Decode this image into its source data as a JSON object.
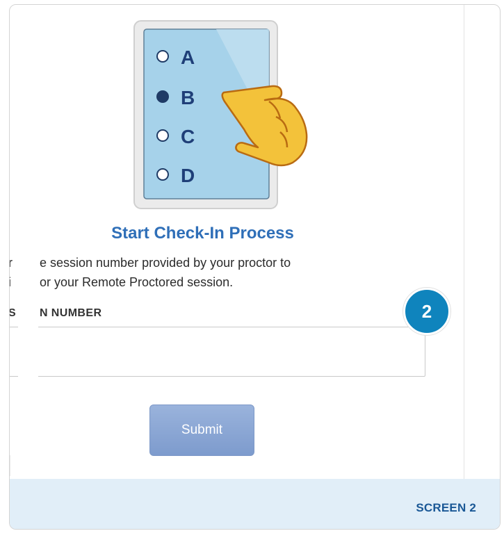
{
  "illustration": {
    "options": [
      {
        "letter": "A",
        "selected": false
      },
      {
        "letter": "B",
        "selected": true
      },
      {
        "letter": "C",
        "selected": false
      },
      {
        "letter": "D",
        "selected": false
      }
    ]
  },
  "main": {
    "title": "Start Check-In Process",
    "instruction_line1": "e session number provided by your proctor to",
    "instruction_line2": "or your Remote Proctored session.",
    "cut_fragment1": "r",
    "cut_fragment2": "i",
    "field_label_cut": "S",
    "field_label": "N NUMBER",
    "field_value": "",
    "field_placeholder": "",
    "submit_label": "Submit"
  },
  "callout": {
    "number": "2"
  },
  "footer": {
    "label": "SCREEN 2"
  },
  "colors": {
    "title": "#2f6fb8",
    "submit_bg": "#8aa6d4",
    "callout": "#0f84bd",
    "footer_bg": "#e1eef8",
    "footer_text": "#1a5896"
  }
}
